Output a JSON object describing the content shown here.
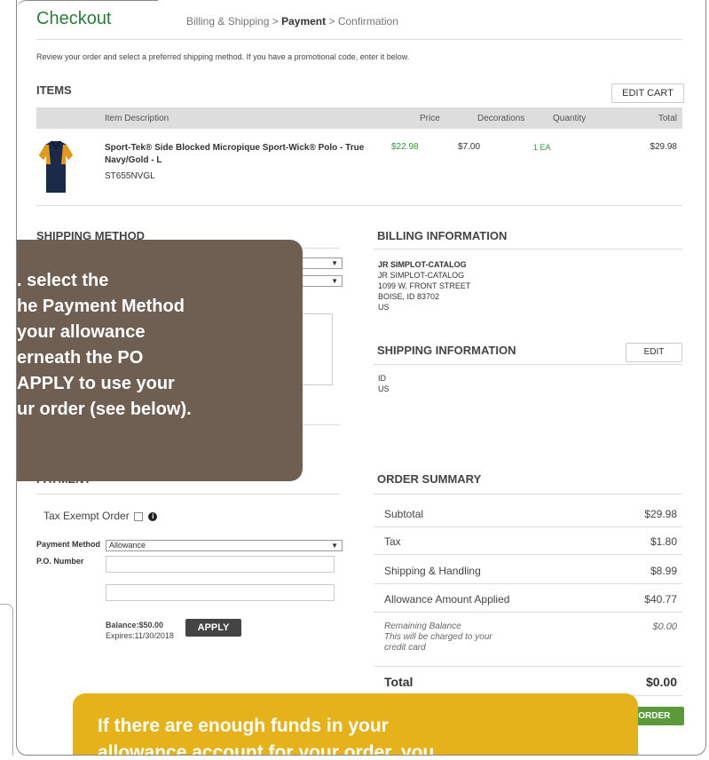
{
  "header": {
    "title": "Checkout",
    "crumb_1": "Billing & Shipping",
    "sep": ">",
    "crumb_2": "Payment",
    "crumb_3": "Confirmation"
  },
  "intro": "Review your order and select a preferred shipping method. If you have a promotional code, enter it below.",
  "items": {
    "heading": "ITEMS",
    "edit_cart": "EDIT CART",
    "columns": [
      "Item Description",
      "Price",
      "Decorations",
      "Quantity",
      "Total"
    ],
    "row": {
      "name_line1": "Sport-Tek® Side Blocked Micropique Sport-Wick® Polo - True",
      "name_line2": "Navy/Gold - L",
      "sku": "ST655NVGL",
      "price": "$22.98",
      "decorations": "$7.00",
      "quantity": "1 EA",
      "total": "$29.98"
    }
  },
  "shipping_method": {
    "heading": "SHIPPING METHOD"
  },
  "billing": {
    "heading": "BILLING INFORMATION",
    "lines": [
      "JR SIMPLOT-CATALOG",
      "JR SIMPLOT-CATALOG",
      "1099 W. FRONT STREET",
      "BOISE, ID 83702",
      "US"
    ]
  },
  "shipping_info": {
    "heading": "SHIPPING INFORMATION",
    "edit": "EDIT",
    "lines": [
      "ID",
      "US"
    ]
  },
  "payment": {
    "heading": "PAYMENT",
    "tax_exempt": "Tax Exempt Order",
    "method_label": "Payment Method",
    "method_value": "Allowance",
    "po_label": "P.O. Number",
    "balance": "Balance:$50.00",
    "expires": "Expires:11/30/2018",
    "apply": "APPLY"
  },
  "order_summary": {
    "heading": "ORDER SUMMARY",
    "rows": [
      {
        "label": "Subtotal",
        "value": "$29.98"
      },
      {
        "label": "Tax",
        "value": "$1.80"
      },
      {
        "label": "Shipping & Handling",
        "value": "$8.99"
      },
      {
        "label": "Allowance Amount Applied",
        "value": "$40.77"
      }
    ],
    "remaining_1": "Remaining Balance",
    "remaining_2": "This will be charged to your",
    "remaining_3": "credit card",
    "remaining_value": "$0.00",
    "total_label": "Total",
    "total_value": "$0.00",
    "place_order": "PLACE ORDER"
  },
  "tooltip_1": {
    "lines": [
      ". select the",
      "he Payment Method",
      " your allowance",
      "erneath the PO",
      "APPLY to use your",
      "ur order (see below)."
    ]
  },
  "tooltip_2": {
    "lines": [
      "If there are enough funds in your",
      "allowance account for your order, you"
    ]
  },
  "colors": {
    "brand_green": "#2e7a3c",
    "tooltip_brown": "#6e5f52",
    "tooltip_gold": "#e6b21c",
    "place_order_green": "#5a9a3a"
  }
}
